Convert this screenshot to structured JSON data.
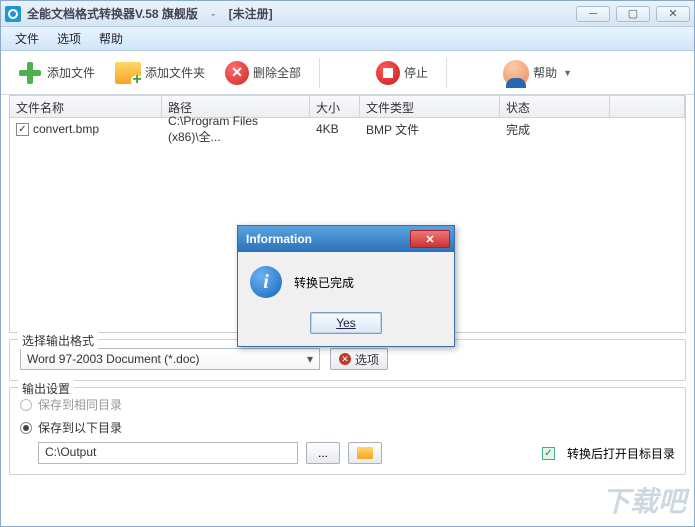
{
  "titlebar": {
    "app_name": "全能文档格式转换器V.58 旗舰版",
    "status": "[未注册]"
  },
  "menu": {
    "file": "文件",
    "options": "选项",
    "help": "帮助"
  },
  "toolbar": {
    "add_file": "添加文件",
    "add_folder": "添加文件夹",
    "delete_all": "删除全部",
    "stop": "停止",
    "help": "帮助"
  },
  "columns": {
    "name": "文件名称",
    "path": "路径",
    "size": "大小",
    "type": "文件类型",
    "status": "状态"
  },
  "rows": [
    {
      "checked": true,
      "name": "convert.bmp",
      "path": "C:\\Program Files (x86)\\全...",
      "size": "4KB",
      "type": "BMP 文件",
      "status": "完成"
    }
  ],
  "format": {
    "legend": "选择输出格式",
    "selected": "Word 97-2003 Document (*.doc)",
    "options_btn": "选项"
  },
  "output": {
    "legend": "输出设置",
    "same_dir": "保存到相同目录",
    "below_dir": "保存到以下目录",
    "path": "C:\\Output",
    "browse": "...",
    "open_after": "转换后打开目标目录"
  },
  "dialog": {
    "title": "Information",
    "message": "转换已完成",
    "yes": "Yes"
  },
  "watermark": "下载吧"
}
